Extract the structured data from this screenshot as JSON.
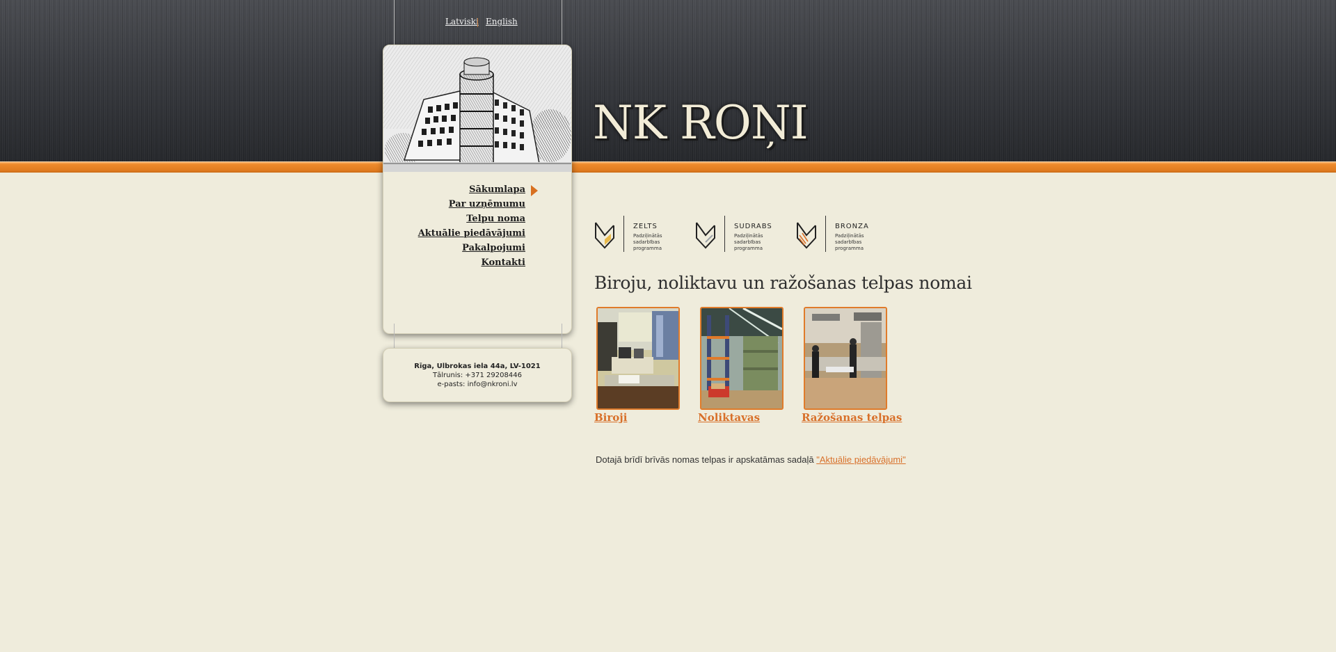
{
  "language": {
    "lv": "Latviski",
    "en": "English"
  },
  "site": {
    "title": "NK ROŅI"
  },
  "nav": {
    "items": [
      {
        "label": "Sākumlapa",
        "active": true
      },
      {
        "label": "Par uzņēmumu"
      },
      {
        "label": "Telpu noma"
      },
      {
        "label": "Aktuālie piedāvājumi"
      },
      {
        "label": "Pakalpojumi"
      },
      {
        "label": "Kontakti"
      }
    ]
  },
  "contact": {
    "address": "Rīga, Ulbrokas iela 44a, LV-1021",
    "phone": "Tālrunis: +371 29208446",
    "email": "e-pasts: info@nkroni.lv"
  },
  "badges": [
    {
      "name": "ZELTS",
      "subtitle": "Padziļinātās sadarbības programma",
      "color": "#e8b94a"
    },
    {
      "name": "SUDRABS",
      "subtitle": "Padziļinātās sadarbības programma",
      "color": "#9aa0a6"
    },
    {
      "name": "BRONZA",
      "subtitle": "Padziļinātās sadarbības programma",
      "color": "#d8702a"
    }
  ],
  "main": {
    "heading": "Biroju, noliktavu un ražošanas telpas nomai",
    "cards": [
      {
        "label": "Biroji"
      },
      {
        "label": "Noliktavas"
      },
      {
        "label": "Ražošanas telpas"
      }
    ],
    "notice_text": "Dotajā brīdī brīvās nomas telpas ir apskatāmas sadaļā ",
    "notice_link": "\"Aktuālie piedāvājumi\""
  },
  "colors": {
    "accent": "#d8702a",
    "header_dark": "#2b2d31",
    "background": "#efecdc"
  }
}
